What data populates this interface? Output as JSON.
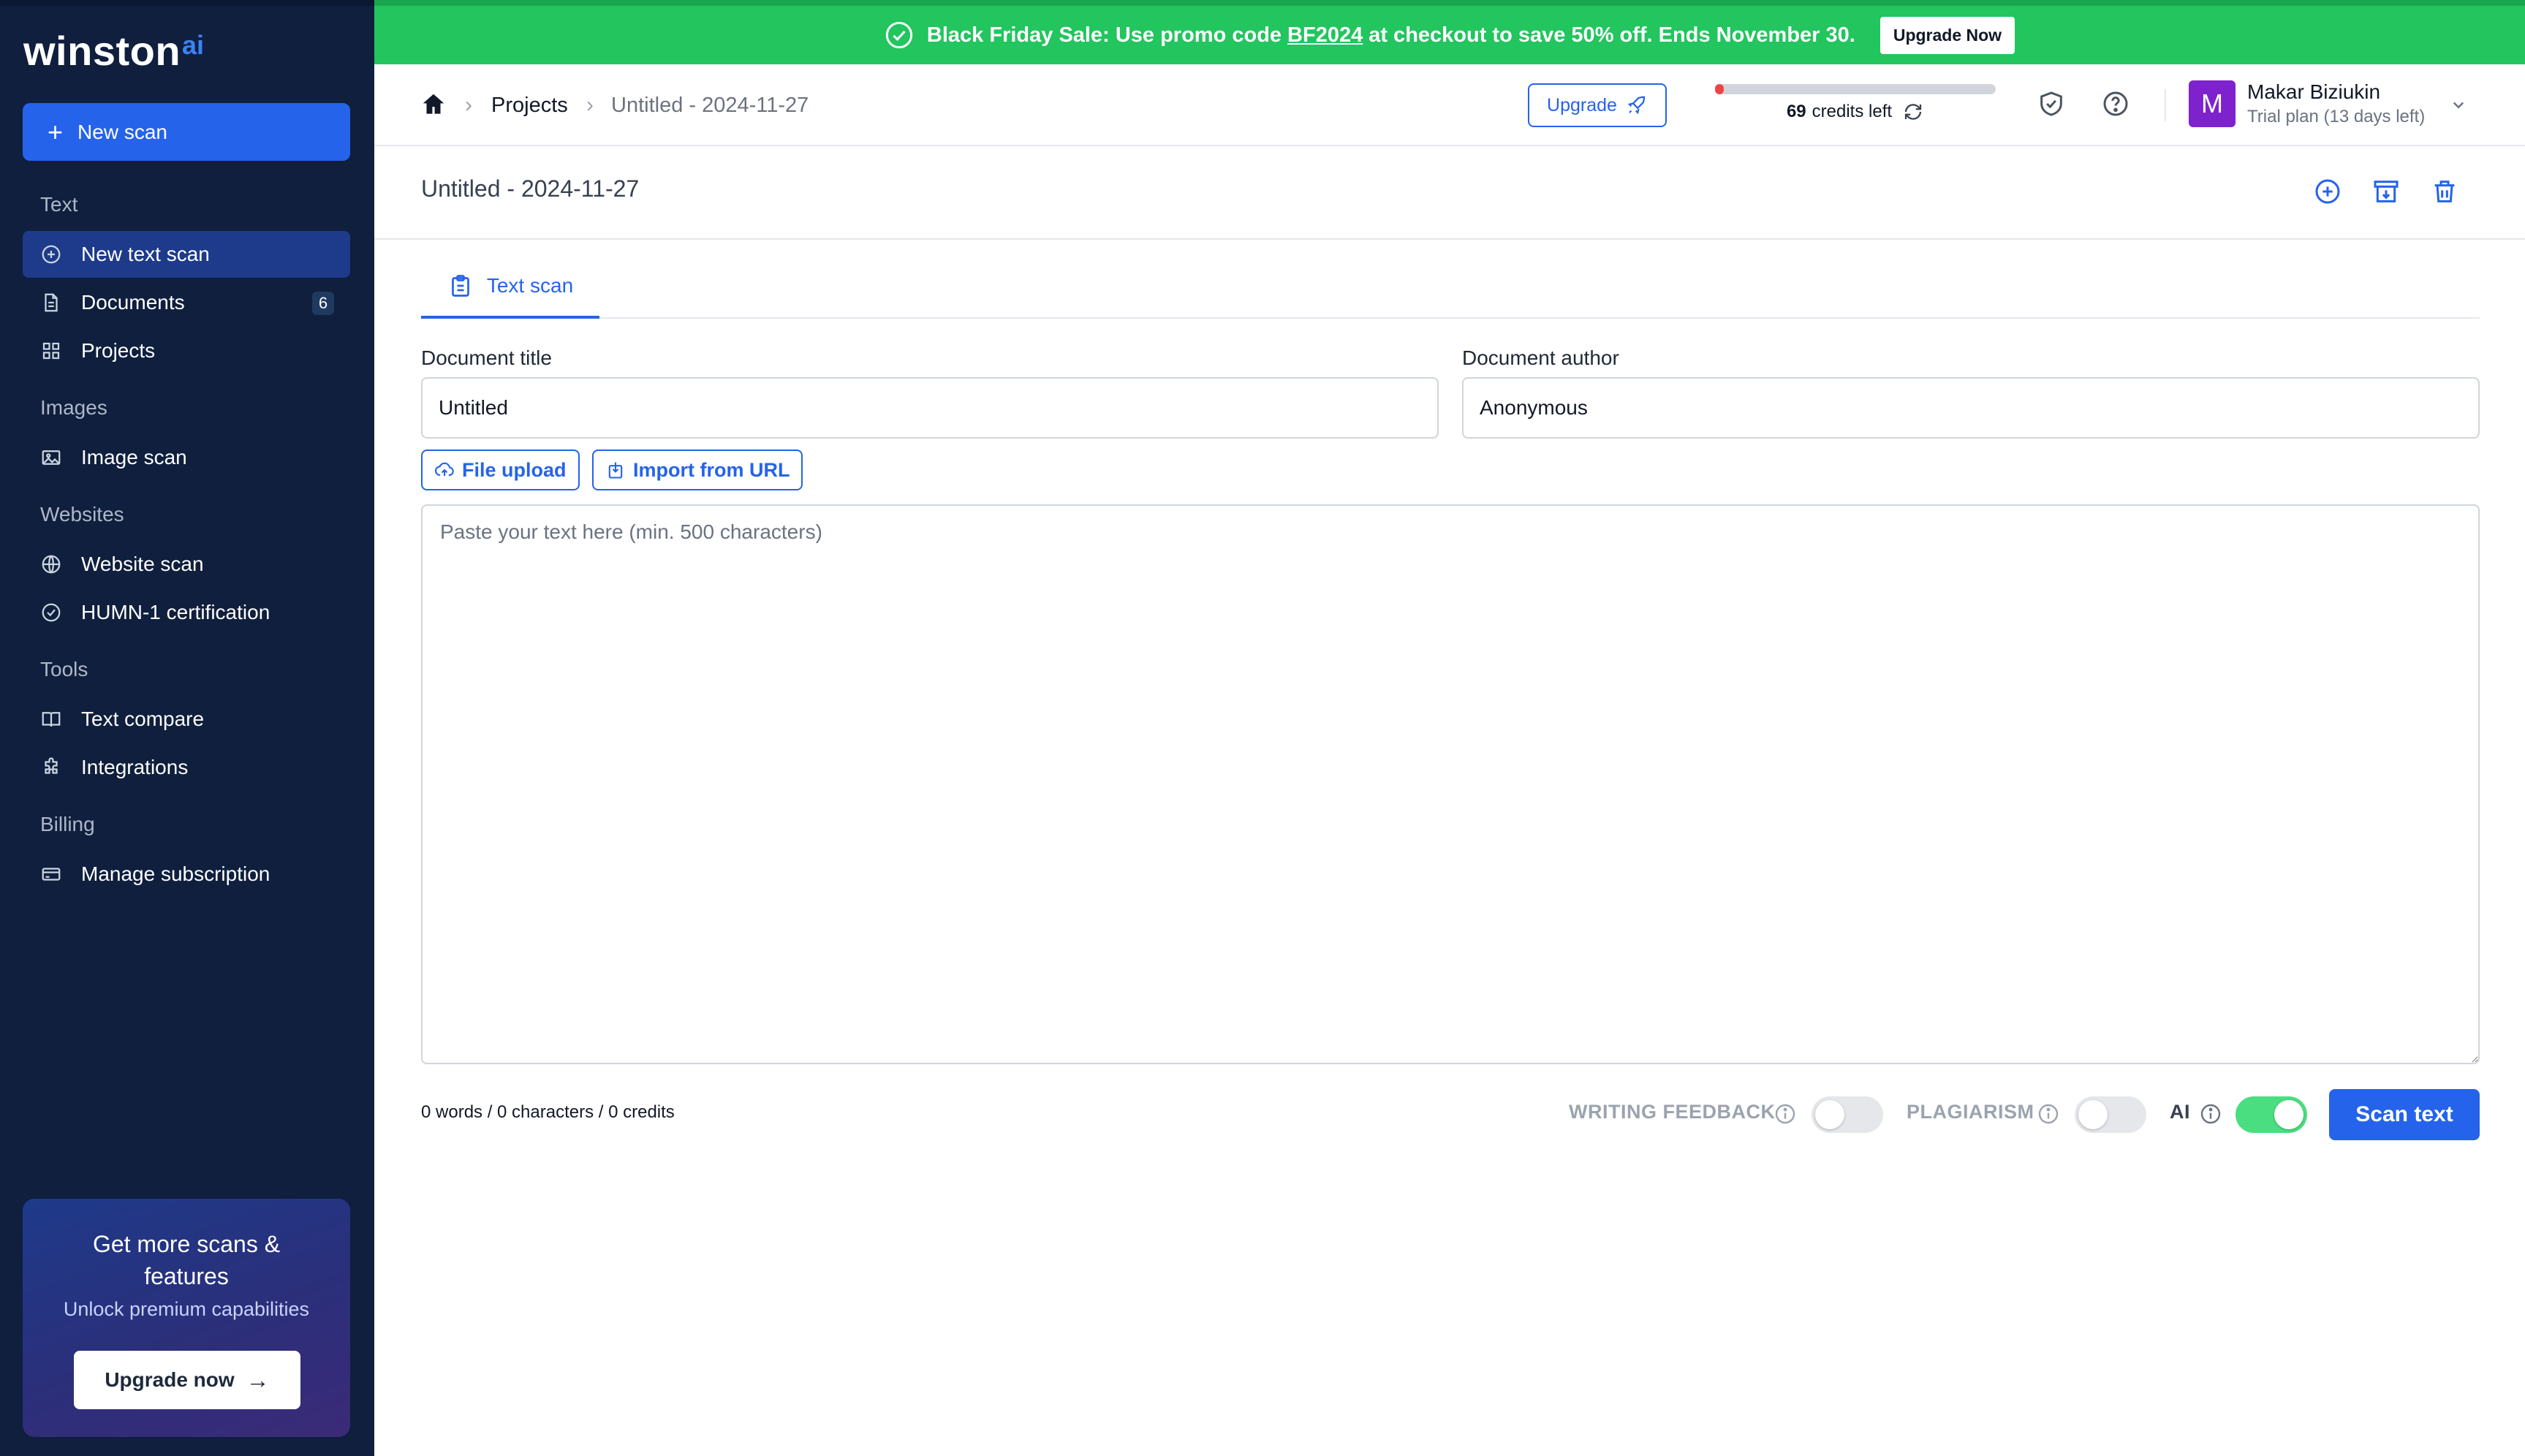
{
  "sidebar": {
    "logo_main": "winston",
    "logo_ai": "ai",
    "new_scan": "New scan",
    "sections": {
      "text": "Text",
      "images": "Images",
      "websites": "Websites",
      "tools": "Tools",
      "billing": "Billing"
    },
    "items": {
      "new_text_scan": "New text scan",
      "documents": "Documents",
      "documents_count": "6",
      "projects": "Projects",
      "image_scan": "Image scan",
      "website_scan": "Website scan",
      "humn": "HUMN-1 certification",
      "text_compare": "Text compare",
      "integrations": "Integrations",
      "manage_subscription": "Manage subscription"
    },
    "promo": {
      "title": "Get more scans & features",
      "subtitle": "Unlock premium capabilities",
      "button": "Upgrade now"
    }
  },
  "banner": {
    "text_before": "Black Friday Sale: Use promo code",
    "code": "BF2024",
    "text_after": "at checkout to save 50% off. Ends November 30.",
    "button": "Upgrade Now"
  },
  "topbar": {
    "crumb_projects": "Projects",
    "crumb_current": "Untitled - 2024-11-27",
    "upgrade": "Upgrade",
    "credits_count": "69",
    "credits_suffix": "credits left",
    "credits_fraction": 0.03,
    "user_initial": "M",
    "user_name": "Makar Biziukin",
    "user_plan": "Trial plan (13 days left)"
  },
  "doc": {
    "title": "Untitled - 2024-11-27"
  },
  "main": {
    "tab_label": "Text scan",
    "title_label": "Document title",
    "title_value": "Untitled",
    "author_label": "Document author",
    "author_value": "Anonymous",
    "file_upload": "File upload",
    "import_url": "Import from URL",
    "textarea_placeholder": "Paste your text here (min. 500 characters)",
    "counts": "0 words / 0 characters / 0 credits",
    "writing_feedback": "WRITING FEEDBACK",
    "writing_feedback_on": false,
    "plagiarism": "PLAGIARISM",
    "plagiarism_on": false,
    "ai": "AI",
    "ai_on": true,
    "scan_button": "Scan text"
  },
  "colors": {
    "sidebar_bg": "#0f1f3d",
    "accent": "#2563eb",
    "banner": "#22c55e",
    "toggle_on": "#4ade80"
  }
}
